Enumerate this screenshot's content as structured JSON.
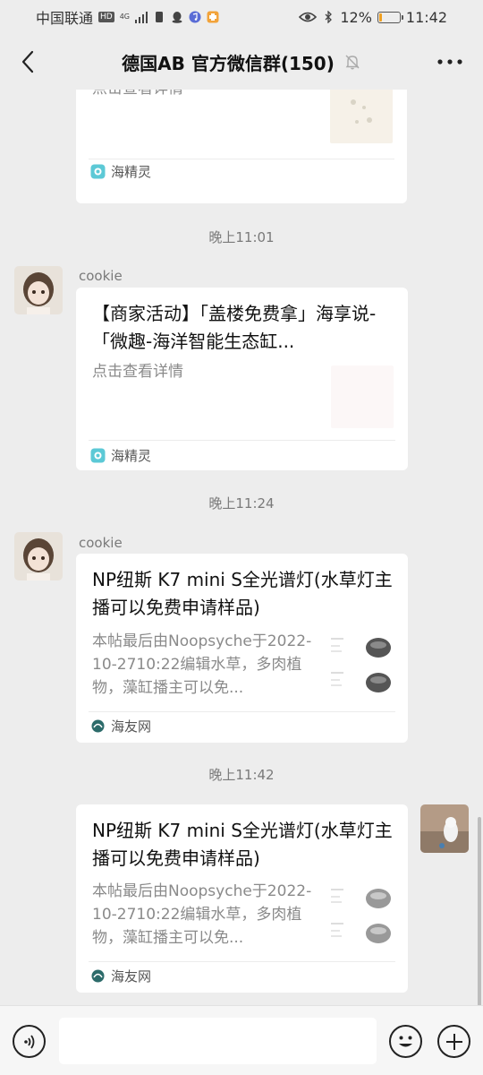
{
  "status_bar": {
    "carrier": "中国联通",
    "network_badge": "HD",
    "signal_label": "4G",
    "battery": "12%",
    "battery_level": 0.12,
    "time": "11:42",
    "icons": [
      "signal-icon",
      "sim-icon",
      "qq-icon",
      "music-icon",
      "app-icon",
      "eye-icon",
      "bluetooth-icon",
      "battery-icon"
    ]
  },
  "header": {
    "title": "德国AB  官方微信群(150)",
    "back_icon": "chevron-left-icon",
    "mute_icon": "bell-off-icon",
    "more_icon": "ellipsis-icon"
  },
  "messages": [
    {
      "desc": "点击查看详情",
      "source": "海精灵"
    },
    {
      "time": "晚上11:01",
      "sender": "cookie",
      "title": "【商家活动】「盖楼免费拿」海享说-「微趣-海洋智能生态缸...",
      "desc": "点击查看详情",
      "source": "海精灵"
    },
    {
      "time": "晚上11:24",
      "sender": "cookie",
      "title": "NP纽斯 K7 mini S全光谱灯(水草灯主播可以免费申请样品)",
      "desc": "本帖最后由Noopsyche于2022-10-2710:22编辑水草，多肉植物，藻缸播主可以免...",
      "source": "海友网"
    },
    {
      "time": "晚上11:42",
      "title": "NP纽斯 K7 mini S全光谱灯(水草灯主播可以免费申请样品)",
      "desc": "本帖最后由Noopsyche于2022-10-2710:22编辑水草，多肉植物，藻缸播主可以免...",
      "source": "海友网"
    }
  ],
  "input_bar": {
    "placeholder": "",
    "voice_icon": "voice-icon",
    "emoji_icon": "emoji-icon",
    "plus_icon": "plus-icon"
  },
  "colors": {
    "background": "#ededed",
    "card": "#ffffff",
    "accent_green": "#3fbf74"
  }
}
